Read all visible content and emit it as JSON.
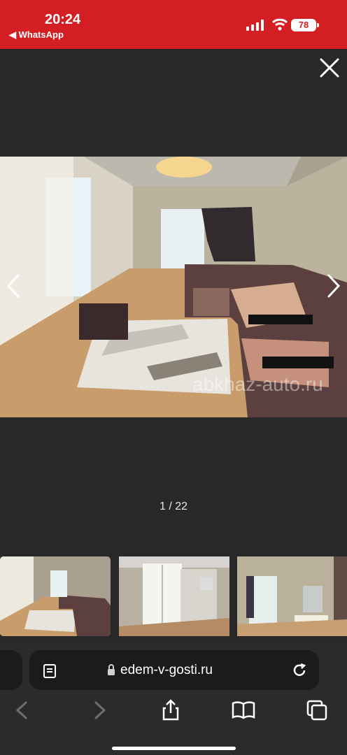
{
  "status": {
    "time": "20:24",
    "back_app": "◀ WhatsApp",
    "battery": "78",
    "icons": [
      "signal-icon",
      "wifi-icon",
      "battery-icon"
    ]
  },
  "viewer": {
    "counter": "1 / 22",
    "close_icon": "close-icon",
    "watermark": "abkhaz-auto.ru",
    "thumbs": [
      "living room with sofa",
      "bedroom with wardrobe",
      "bedroom with mirror"
    ]
  },
  "browser": {
    "url": "edem-v-gosti.ru",
    "icons": [
      "back-icon",
      "forward-icon",
      "share-icon",
      "bookmarks-icon",
      "tabs-icon",
      "reader-icon",
      "lock-icon",
      "reload-icon"
    ]
  },
  "colors": {
    "status_red": "#d31f23",
    "viewer_bg": "#282828",
    "browser_bg": "#2b2b2b"
  }
}
